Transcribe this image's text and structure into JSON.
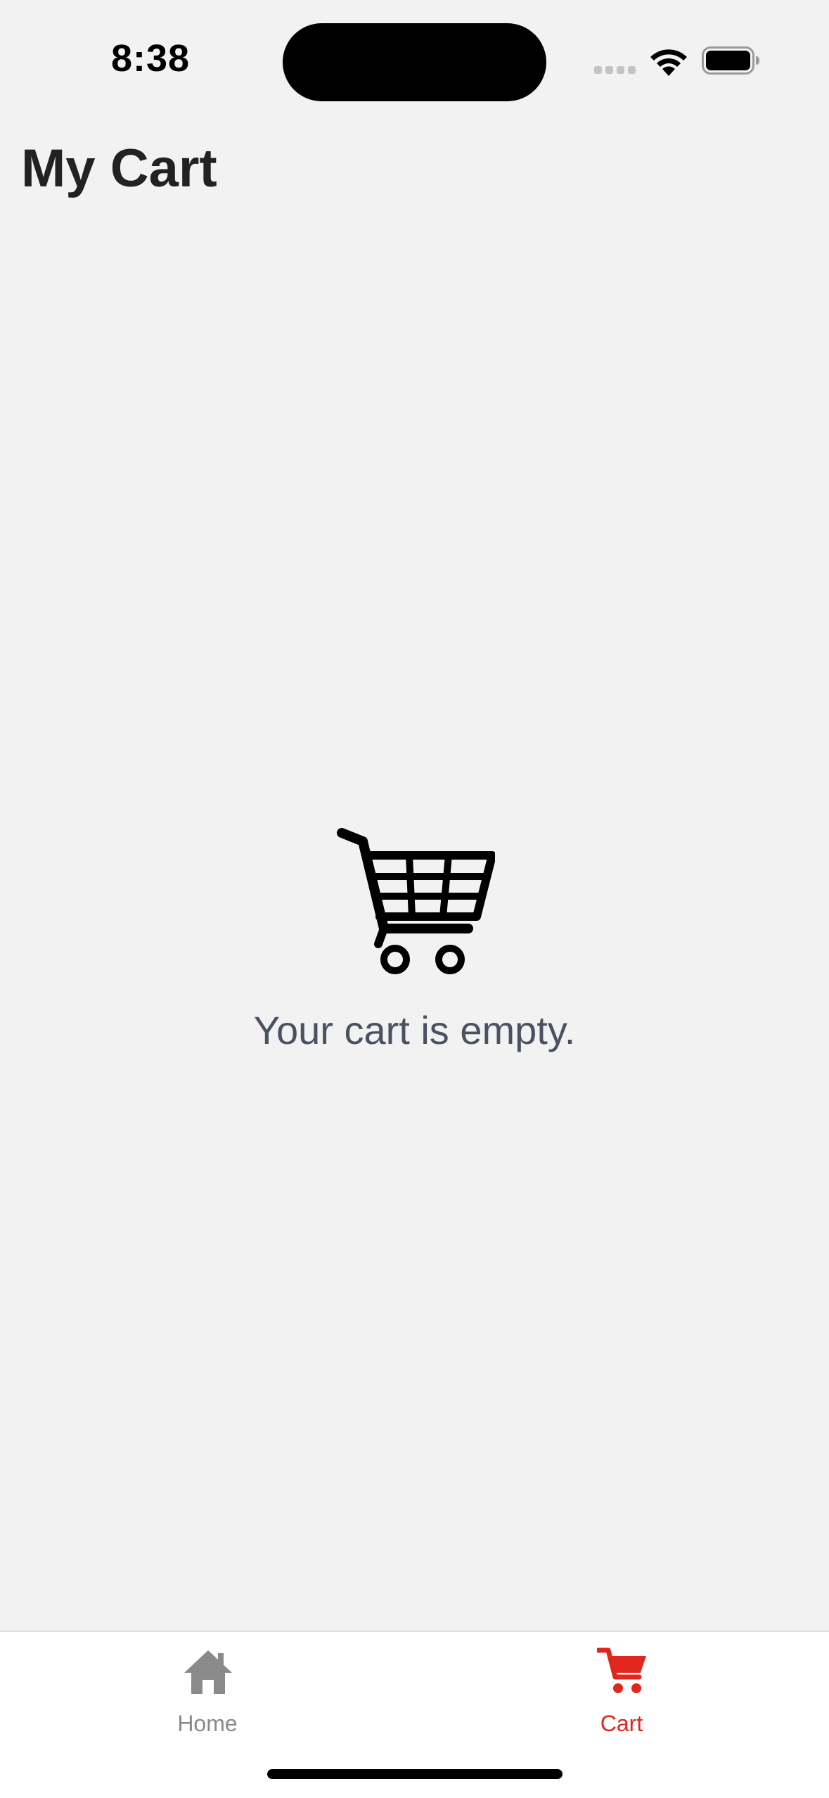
{
  "status_bar": {
    "time": "8:38"
  },
  "header": {
    "title": "My Cart"
  },
  "empty_state": {
    "icon": "shopping-cart-icon",
    "message": "Your cart is empty."
  },
  "tab_bar": {
    "tabs": [
      {
        "label": "Home",
        "icon": "home-icon",
        "active": false,
        "color": "#8a8a8a"
      },
      {
        "label": "Cart",
        "icon": "cart-icon",
        "active": true,
        "color": "#e0261d"
      }
    ]
  },
  "colors": {
    "background": "#f2f2f2",
    "accent": "#e0261d",
    "inactive_tab": "#8a8a8a",
    "title": "#222222",
    "empty_text": "#4a5160"
  }
}
